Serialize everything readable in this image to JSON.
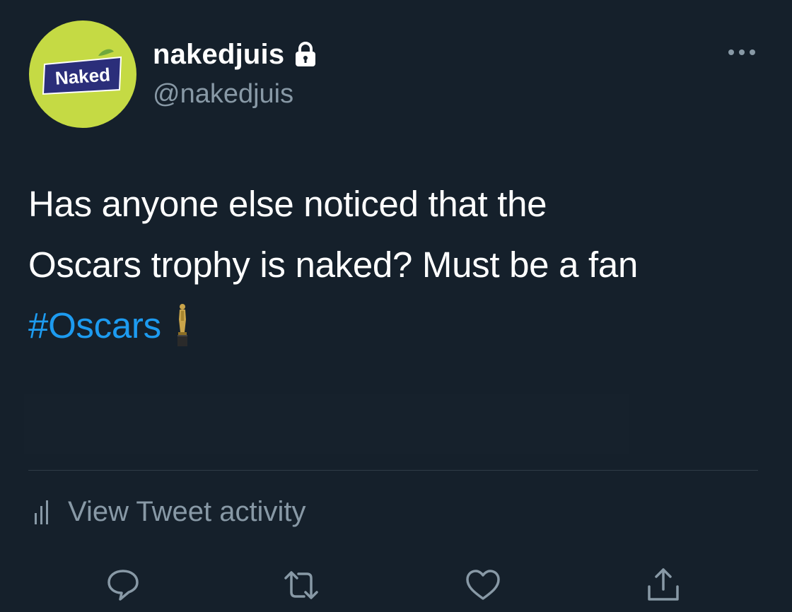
{
  "author": {
    "display_name": "nakedjuis",
    "handle": "@nakedjuis",
    "avatar_text": "Naked",
    "protected": true
  },
  "tweet": {
    "line1": "Has anyone else noticed that the",
    "line2": "Oscars trophy is naked? Must be a fan",
    "hashtag": "#Oscars",
    "emoji": "trophy-statue-icon"
  },
  "activity": {
    "label": "View Tweet activity"
  },
  "actions": [
    "reply-icon",
    "retweet-icon",
    "like-icon",
    "share-icon"
  ],
  "colors": {
    "background": "#15202b",
    "text": "#ffffff",
    "secondary": "#8899a6",
    "link": "#1d9bf0",
    "avatar_bg": "#c5da44",
    "avatar_badge": "#2b2e7a"
  }
}
